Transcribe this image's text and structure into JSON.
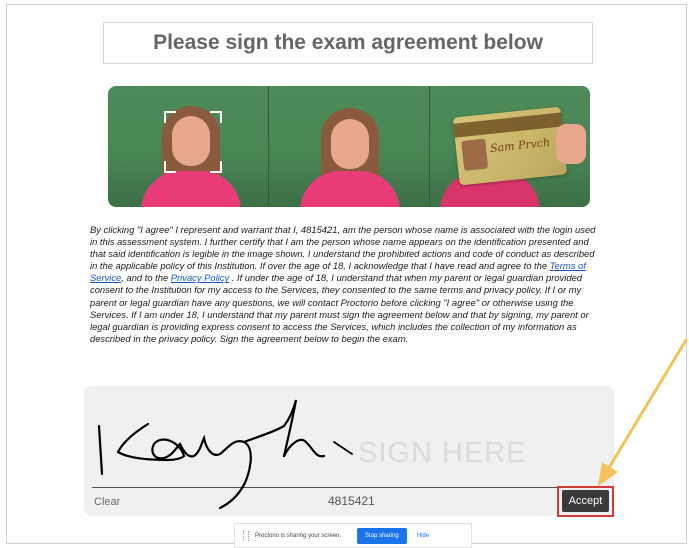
{
  "title": "Please sign the exam agreement below",
  "agreement": {
    "p1": "By clicking \"I agree\" I represent and warrant that I, 4815421, am the person whose name is associated with the login used in this assessment system. I further certify that I am the person whose name appears on the identification presented and that said identification is legible in the image shown. I understand the prohibited actions and code of conduct as described in the applicable policy of this Institution. If over the age of 18, I acknowledge that I have read and agree to the ",
    "terms_link": "Terms of Service",
    "p2": ", and to the ",
    "privacy_link": "Privacy Policy",
    "p3": " . If under the age of 18, I understand that when my parent or legal guardian provided consent to the Institution for my access to the Services, they consented to the same terms and privacy policy. If I or my parent or legal guardian have any questions, we will contact Proctorio before clicking \"I agree\" or otherwise using the Services. If I am under 18, I understand that my parent must sign the agreement below and that by signing, my parent or legal guardian is providing express consent to access the Services, which includes the collection of my information as described in the privacy policy. Sign the agreement below to begin the exam."
  },
  "id_card": {
    "name_text": "Sam Prvch"
  },
  "signature_pad": {
    "placeholder": "SIGN HERE",
    "clear_label": "Clear",
    "user_id": "4815421",
    "accept_label": "Accept"
  },
  "share_bar": {
    "message": "Proctorio is sharing your screen.",
    "stop_label": "Stop sharing",
    "hide_label": "Hide"
  },
  "colors": {
    "shirt": "#e83c78",
    "background_green": "#4a8654",
    "accept_highlight": "#d23a3a",
    "arrow": "#f4c15a",
    "link": "#1a57c9",
    "stop_button": "#1a73e8"
  }
}
